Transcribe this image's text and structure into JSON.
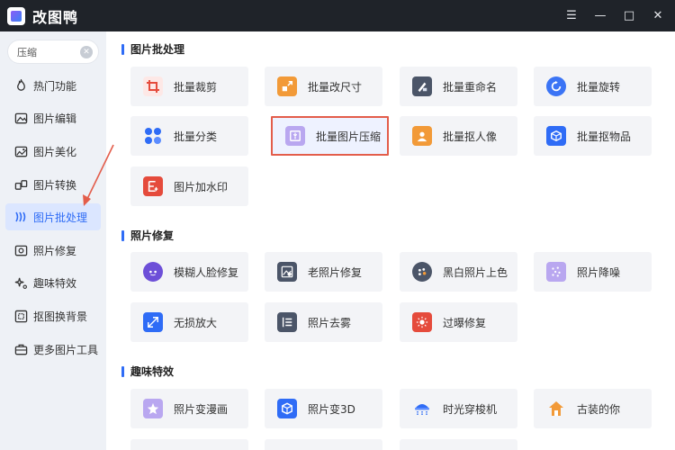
{
  "titlebar": {
    "title": "改图鸭",
    "controls": [
      "☰",
      "—",
      "□",
      "✕"
    ]
  },
  "sidebar": {
    "search": {
      "value": "压缩",
      "placeholder": ""
    },
    "items": [
      {
        "label": "热门功能",
        "icon": "fire-icon"
      },
      {
        "label": "图片编辑",
        "icon": "image-edit-icon"
      },
      {
        "label": "图片美化",
        "icon": "image-beautify-icon"
      },
      {
        "label": "图片转换",
        "icon": "convert-icon"
      },
      {
        "label": "图片批处理",
        "icon": "batch-icon",
        "active": true
      },
      {
        "label": "照片修复",
        "icon": "photo-repair-icon"
      },
      {
        "label": "趣味特效",
        "icon": "sparkle-icon"
      },
      {
        "label": "抠图换背景",
        "icon": "cutout-icon"
      },
      {
        "label": "更多图片工具",
        "icon": "toolbox-icon"
      }
    ]
  },
  "sections": [
    {
      "title": "图片批处理",
      "cards": [
        {
          "label": "批量裁剪",
          "icon": "crop-icon"
        },
        {
          "label": "批量改尺寸",
          "icon": "resize-icon"
        },
        {
          "label": "批量重命名",
          "icon": "rename-icon"
        },
        {
          "label": "批量旋转",
          "icon": "rotate-icon"
        },
        {
          "label": "批量分类",
          "icon": "classify-icon"
        },
        {
          "label": "批量图片压缩",
          "icon": "compress-icon",
          "highlighted": true
        },
        {
          "label": "批量抠人像",
          "icon": "portrait-cutout-icon"
        },
        {
          "label": "批量抠物品",
          "icon": "object-cutout-icon"
        },
        {
          "label": "图片加水印",
          "icon": "watermark-icon"
        }
      ]
    },
    {
      "title": "照片修复",
      "cards": [
        {
          "label": "模糊人脸修复",
          "icon": "face-repair-icon"
        },
        {
          "label": "老照片修复",
          "icon": "old-photo-icon"
        },
        {
          "label": "黑白照片上色",
          "icon": "colorize-icon"
        },
        {
          "label": "照片降噪",
          "icon": "denoise-icon"
        },
        {
          "label": "无损放大",
          "icon": "upscale-icon"
        },
        {
          "label": "照片去雾",
          "icon": "dehaze-icon"
        },
        {
          "label": "过曝修复",
          "icon": "exposure-icon"
        }
      ]
    },
    {
      "title": "趣味特效",
      "cards": [
        {
          "label": "照片变漫画",
          "icon": "cartoon-icon"
        },
        {
          "label": "照片变3D",
          "icon": "cube-3d-icon"
        },
        {
          "label": "时光穿梭机",
          "icon": "time-machine-icon"
        },
        {
          "label": "古装的你",
          "icon": "ancient-costume-icon"
        }
      ]
    }
  ],
  "colors": {
    "titlebar": "#1f2329",
    "accent": "#2f6cf6",
    "highlight_border": "#e35d4b",
    "annotation_arrow": "#e35d4b"
  }
}
